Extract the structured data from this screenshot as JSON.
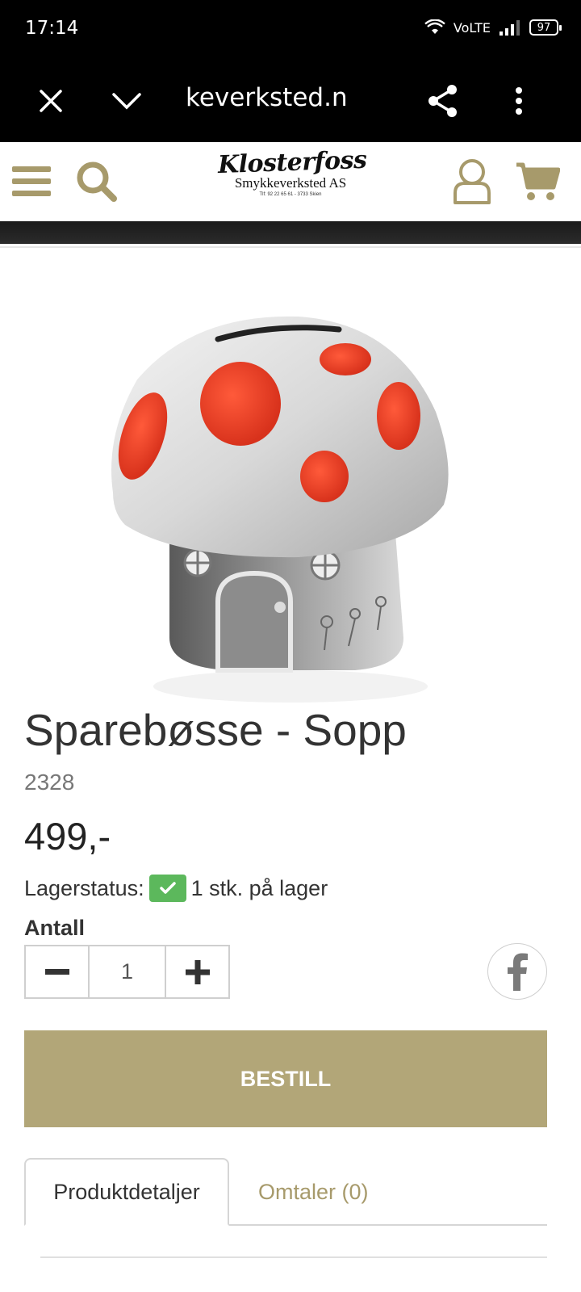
{
  "status_bar": {
    "time": "17:14",
    "network": "VoLTE",
    "battery": "97",
    "icons": [
      "wifi-icon",
      "signal-icon",
      "battery-icon"
    ]
  },
  "browser": {
    "url": "keverksted.no",
    "icons": [
      "close-icon",
      "chevron-down-icon",
      "share-icon",
      "more-vert-icon"
    ]
  },
  "header": {
    "logo_name": "Klosterfoss",
    "logo_sub": "Smykkeverksted AS",
    "logo_tel": "Tlf: 92 22 65 61 - 3733 Skien",
    "accent_color": "#b2a678",
    "icons": [
      "menu-icon",
      "search-icon",
      "user-icon",
      "cart-icon"
    ]
  },
  "product": {
    "title": "Sparebøsse - Sopp",
    "sku": "2328",
    "price": "499,-",
    "stock_label": "Lagerstatus:",
    "stock_value": "1 stk. på lager",
    "stock_color": "#5cb85c",
    "quantity_label": "Antall",
    "quantity": "1",
    "order_button": "BESTILL"
  },
  "tabs": [
    {
      "label": "Produktdetaljer",
      "active": true
    },
    {
      "label": "Omtaler (0)",
      "active": false
    }
  ]
}
